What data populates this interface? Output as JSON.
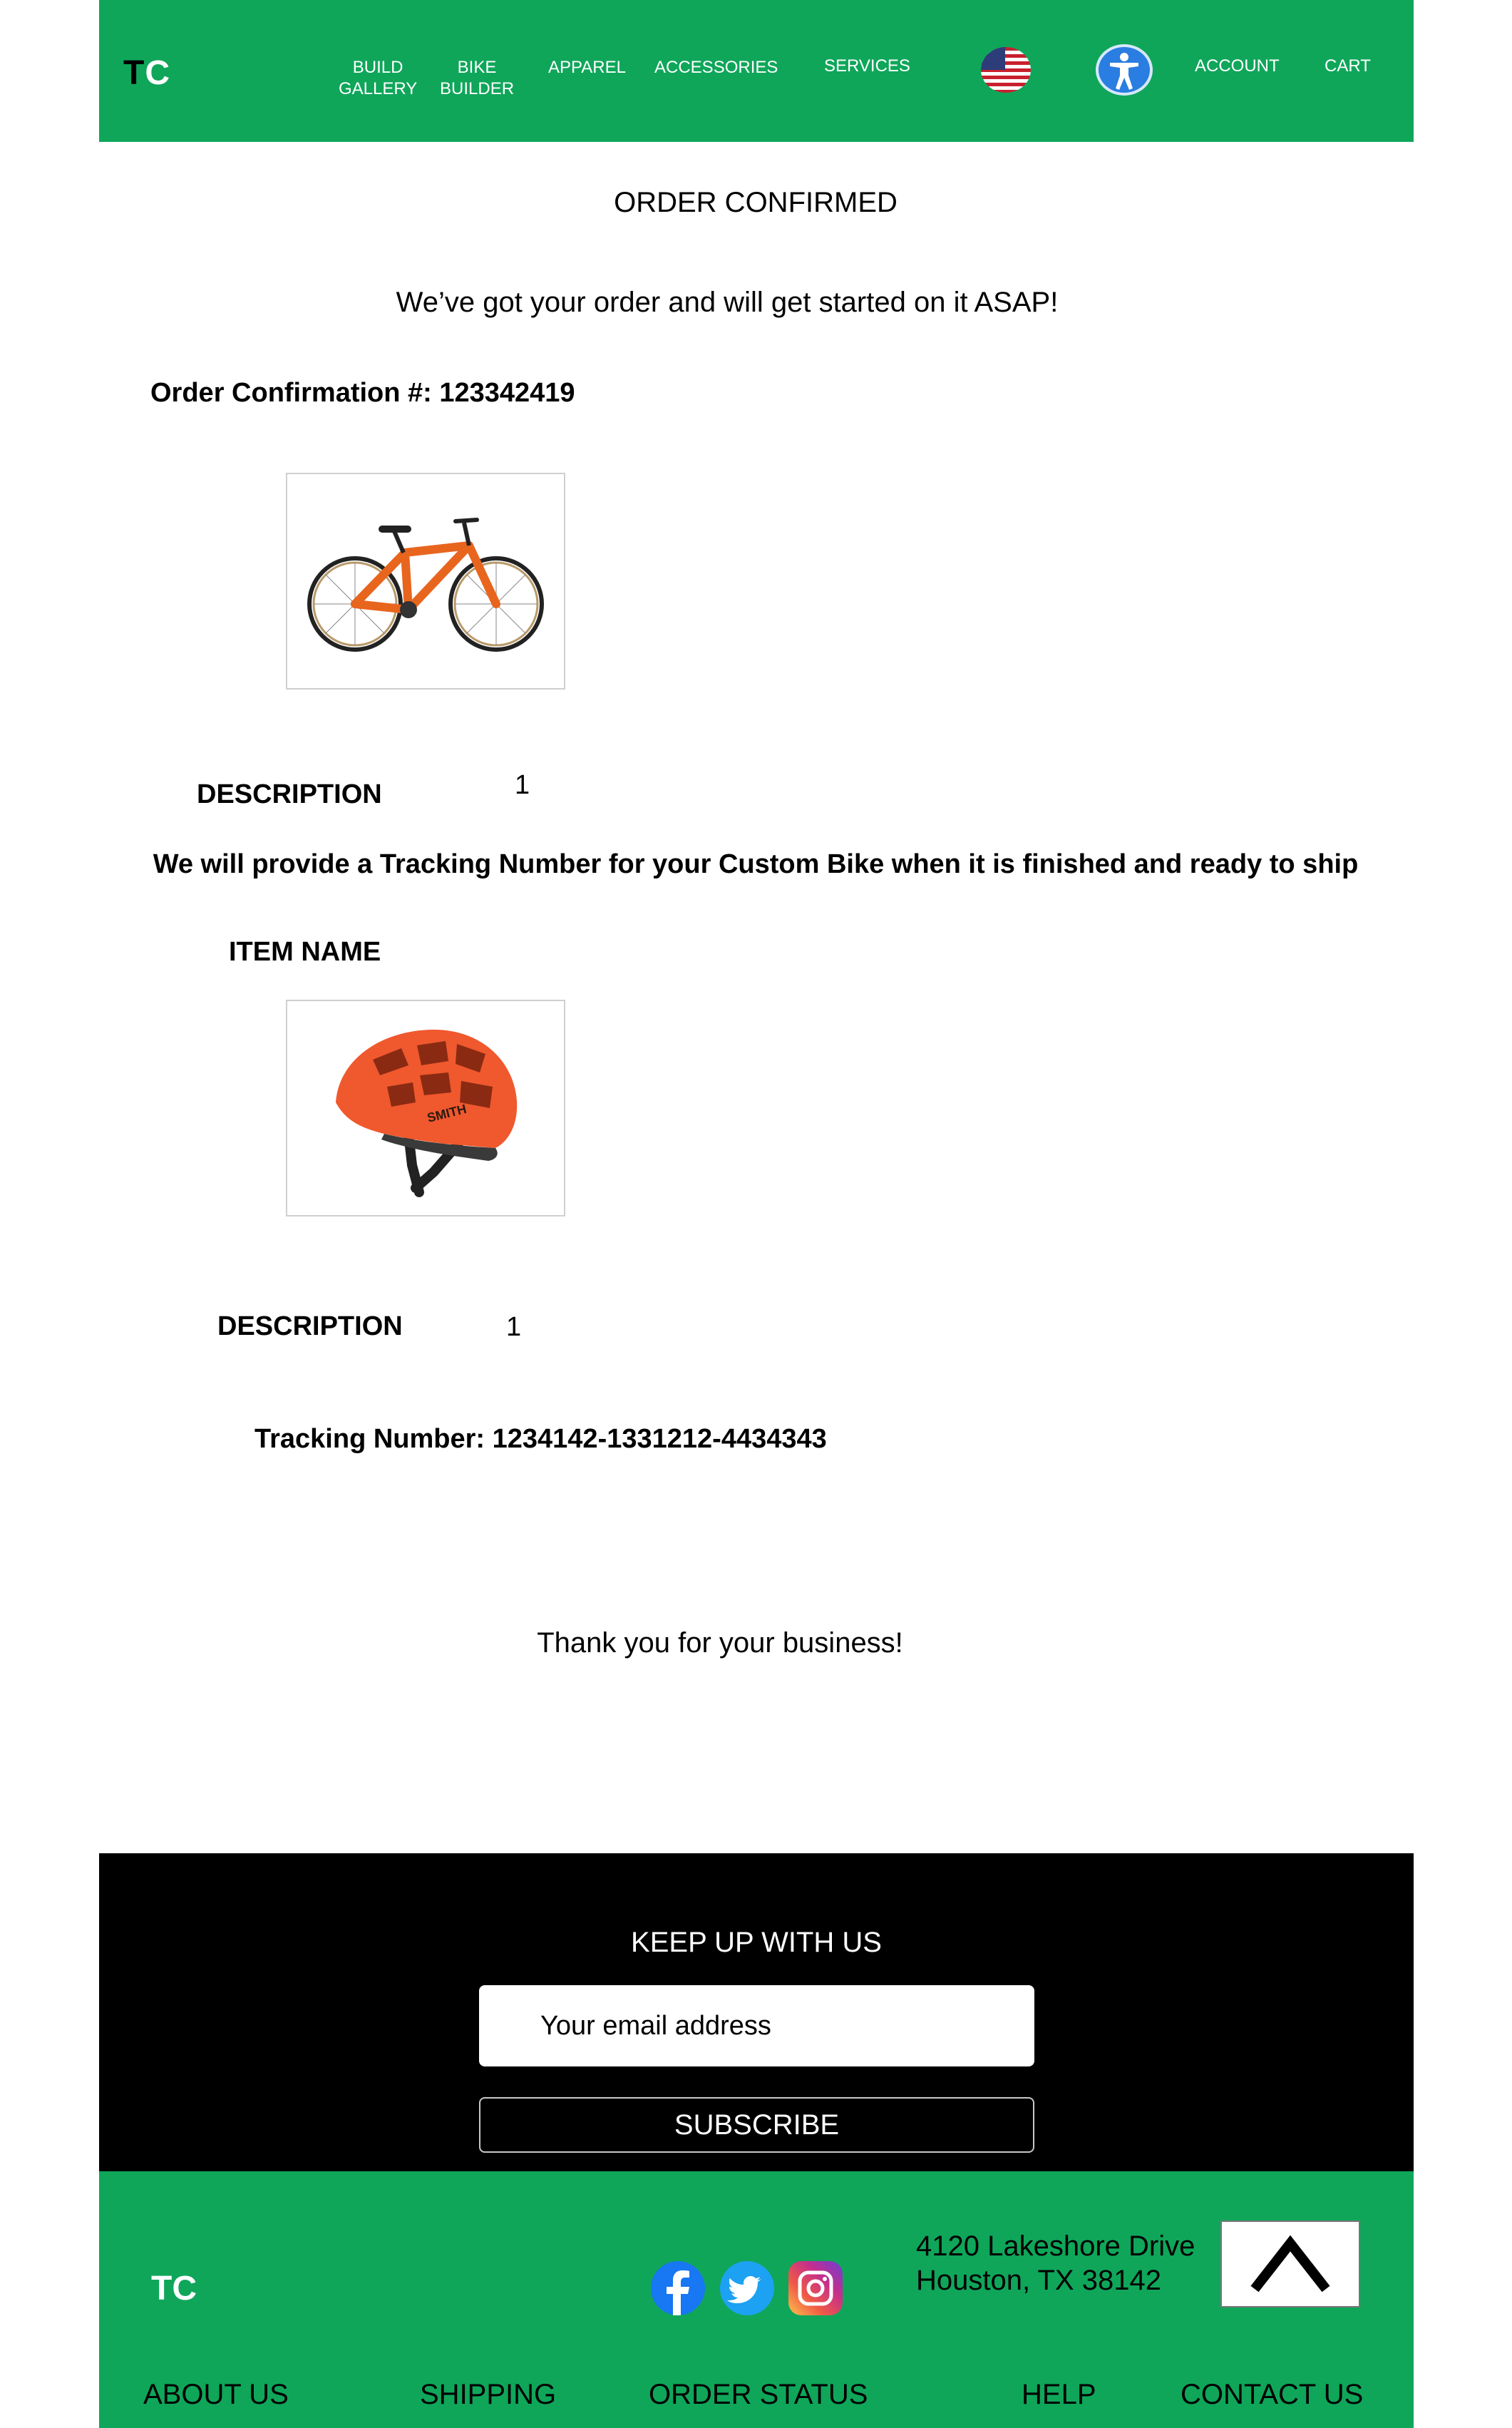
{
  "header": {
    "logo_t": "T",
    "logo_c": "C",
    "nav": {
      "build_gallery_1": "BUILD",
      "build_gallery_2": "GALLERY",
      "bike_builder_1": "BIKE",
      "bike_builder_2": "BUILDER",
      "apparel": "APPAREL",
      "accessories": "ACCESSORIES",
      "services": "SERVICES",
      "account": "ACCOUNT",
      "cart": "CART"
    },
    "flag_icon": "us-flag-icon",
    "accessibility_icon": "accessibility-icon"
  },
  "main": {
    "title": "ORDER CONFIRMED",
    "subtitle": "We’ve got your order and will get started on it ASAP!",
    "confirmation": "Order Confirmation #: 123342419",
    "items": [
      {
        "image": "orange-bike",
        "description_label": "DESCRIPTION",
        "quantity": "1",
        "note": "We will provide a Tracking Number for your Custom Bike when it is finished and ready to ship"
      },
      {
        "name_label": "ITEM NAME",
        "image": "orange-helmet",
        "helmet_brand": "SMITH",
        "description_label": "DESCRIPTION",
        "quantity": "1",
        "tracking": "Tracking Number: 1234142-1331212-4434343"
      }
    ],
    "thanks": "Thank you for your business!"
  },
  "newsletter": {
    "title": "KEEP UP WITH US",
    "email_placeholder": "Your email address",
    "subscribe_label": "SUBSCRIBE"
  },
  "footer": {
    "logo": "TC",
    "address_line1": "4120 Lakeshore Drive",
    "address_line2": "Houston, TX 38142",
    "social": [
      "facebook-icon",
      "twitter-icon",
      "instagram-icon"
    ],
    "links": [
      "ABOUT US",
      "SHIPPING",
      "ORDER STATUS",
      "HELP",
      "CONTACT US"
    ]
  },
  "colors": {
    "brand_green": "#0fa65a",
    "newsletter_bg": "#000000",
    "bike_orange": "#e8651e",
    "helmet_orange": "#f0582e"
  }
}
